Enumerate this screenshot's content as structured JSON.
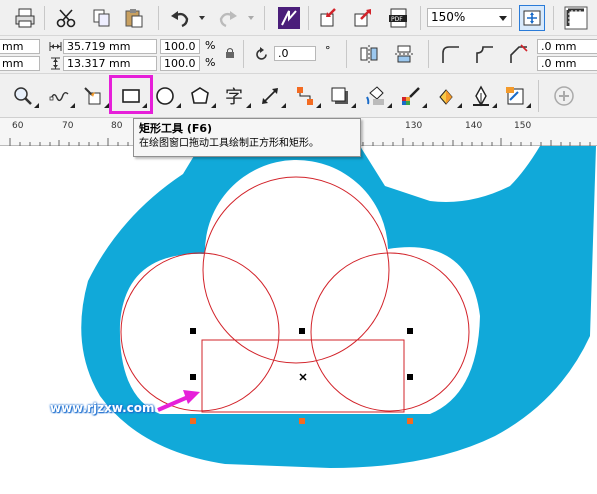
{
  "toolbar": {
    "zoom_value": "150%"
  },
  "property_bar": {
    "x_value": "mm",
    "y_value": "mm",
    "width_value": "35.719 mm",
    "height_value": "13.317 mm",
    "scale_x": "100.0",
    "scale_y": "100.0",
    "percent_symbol": "%",
    "rotation_value": ".0",
    "degree_symbol": "°",
    "corner_radius_1": ".0 mm",
    "corner_radius_2": ".0 mm"
  },
  "ruler": {
    "ticks": [
      "60",
      "70",
      "80",
      "130",
      "140",
      "150"
    ]
  },
  "tooltip": {
    "title": "矩形工具 (F6)",
    "description": "在绘图窗口拖动工具绘制正方形和矩形。"
  },
  "watermark": {
    "text": "www.rjzxw.com"
  },
  "colors": {
    "logo_blue": "#11a9d9",
    "outline_red": "#d2232a",
    "highlight_magenta": "#e61fd9",
    "handle_orange": "#f36b21",
    "arrow_magenta": "#e61fd9",
    "watermark_blue": "#1d6fd0"
  }
}
